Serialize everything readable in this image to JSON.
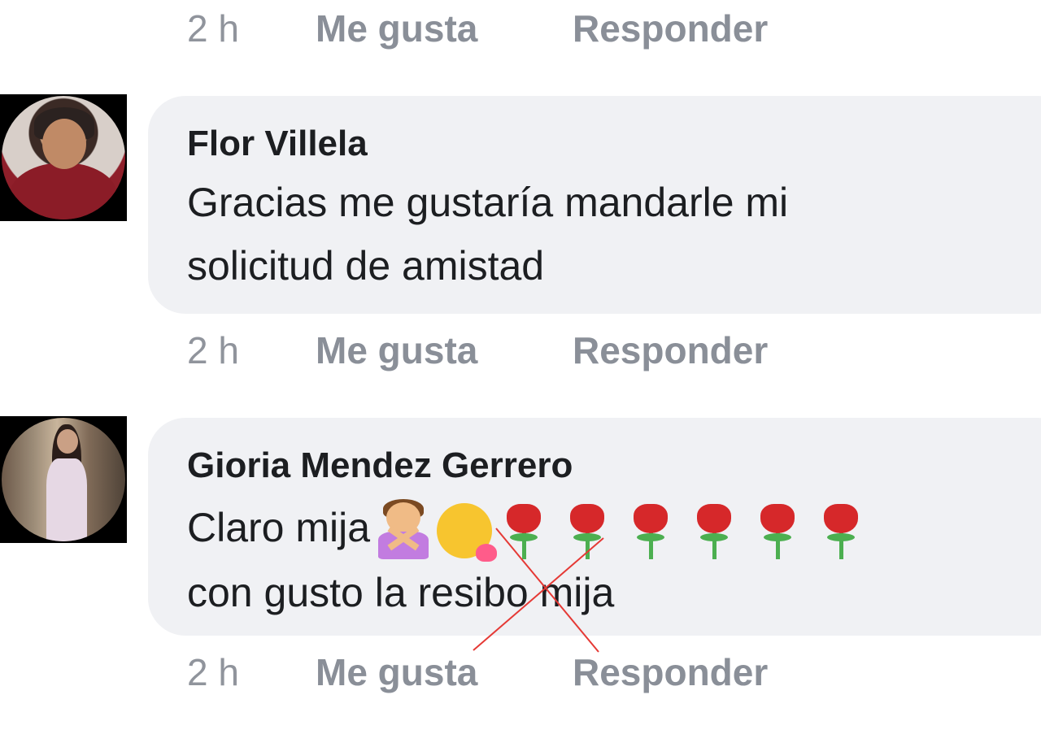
{
  "comments": [
    {
      "meta": {
        "time": "2 h",
        "like": "Me gusta",
        "reply": "Responder"
      }
    },
    {
      "author": "Flor Villela",
      "line1": "Gracias me gustaría mandarle mi",
      "line2": "solicitud de amistad",
      "meta": {
        "time": "2 h",
        "like": "Me gusta",
        "reply": "Responder"
      }
    },
    {
      "author": "Gioria Mendez Gerrero",
      "line1": "Claro mija",
      "line2": "con gusto la resibo mija",
      "emojis": [
        "woman-gesturing-no-icon",
        "face-blowing-kiss-icon",
        "rose-icon",
        "rose-icon",
        "rose-icon",
        "rose-icon",
        "rose-icon",
        "rose-icon"
      ],
      "meta": {
        "time": "2 h",
        "like": "Me gusta",
        "reply": "Responder"
      }
    }
  ],
  "colors": {
    "bubble": "#f0f1f4",
    "meta": "#8a8f98",
    "text": "#1c1e21",
    "annotation": "#e53935"
  }
}
